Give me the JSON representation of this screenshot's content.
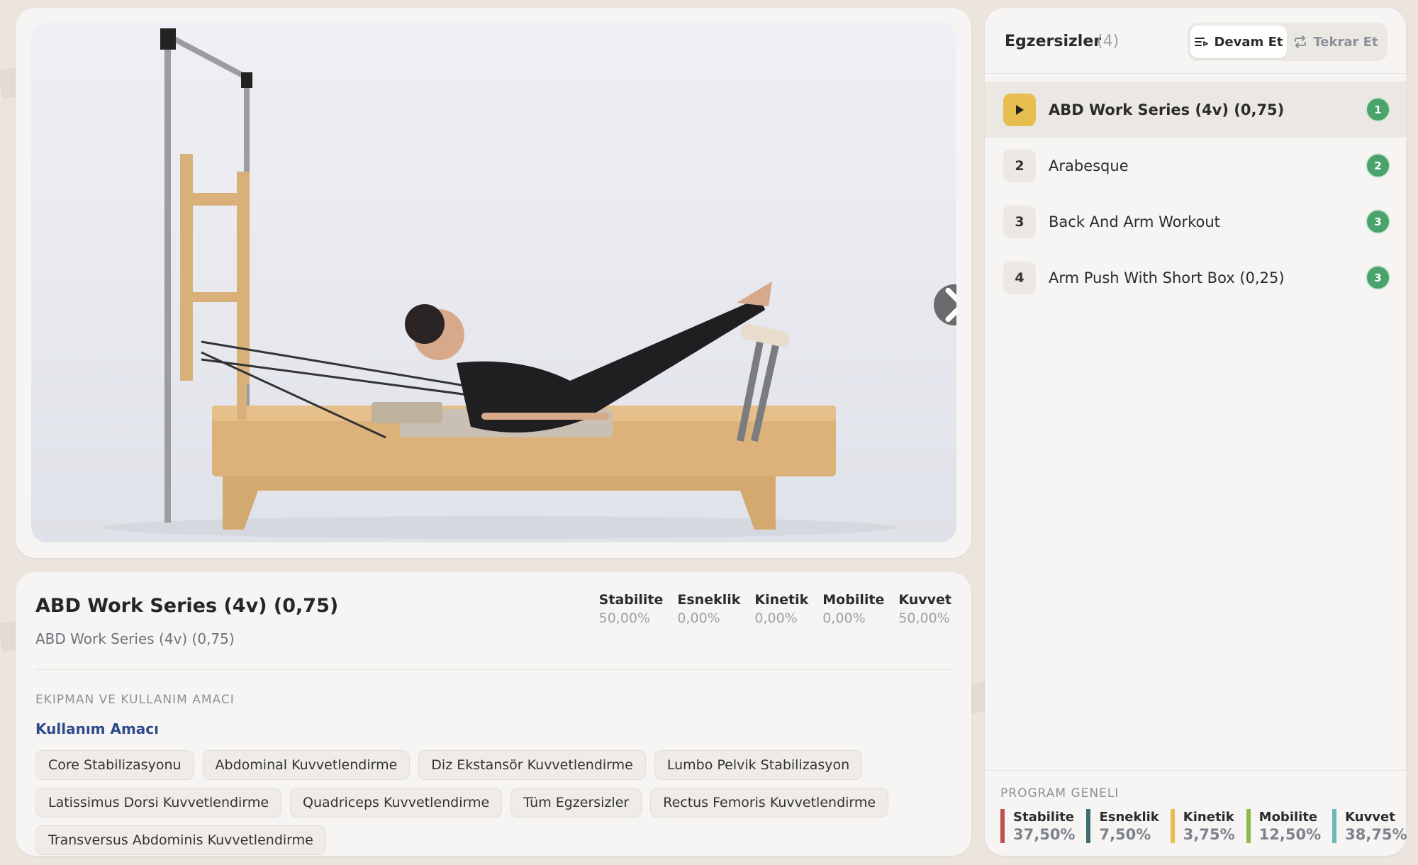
{
  "video": {
    "next_icon": "chevron-right-icon"
  },
  "exercise": {
    "title": "ABD Work Series (4v) (0,75)",
    "subtitle": "ABD Work Series (4v) (0,75)",
    "stats": [
      {
        "name": "Stabilite",
        "value": "50,00%"
      },
      {
        "name": "Esneklik",
        "value": "0,00%"
      },
      {
        "name": "Kinetik",
        "value": "0,00%"
      },
      {
        "name": "Mobilite",
        "value": "0,00%"
      },
      {
        "name": "Kuvvet",
        "value": "50,00%"
      }
    ],
    "section_label": "EKIPMAN VE KULLANIM AMACI",
    "usage_title": "Kullanım Amacı",
    "tags": [
      "Core Stabilizasyonu",
      "Abdominal Kuvvetlendirme",
      "Diz Ekstansör Kuvvetlendirme",
      "Lumbo Pelvik Stabilizasyon",
      "Latissimus Dorsi Kuvvetlendirme",
      "Quadriceps Kuvvetlendirme",
      "Tüm Egzersizler",
      "Rectus Femoris Kuvvetlendirme",
      "Transversus Abdominis Kuvvetlendirme"
    ]
  },
  "sidebar": {
    "title": "Egzersizler",
    "count": "(4)",
    "mode_continue": "Devam Et",
    "mode_repeat": "Tekrar Et",
    "items": [
      {
        "num": "",
        "name": "ABD Work Series (4v) (0,75)",
        "badge": "1",
        "active": true
      },
      {
        "num": "2",
        "name": "Arabesque",
        "badge": "2",
        "active": false
      },
      {
        "num": "3",
        "name": "Back And Arm Workout",
        "badge": "3",
        "active": false
      },
      {
        "num": "4",
        "name": "Arm Push With Short Box (0,25)",
        "badge": "3",
        "active": false
      }
    ],
    "program_label": "PROGRAM GENELI",
    "program_stats": [
      {
        "name": "Stabilite",
        "value": "37,50%",
        "color": "#c0504d"
      },
      {
        "name": "Esneklik",
        "value": "7,50%",
        "color": "#3f6e70"
      },
      {
        "name": "Kinetik",
        "value": "3,75%",
        "color": "#e6bd4e"
      },
      {
        "name": "Mobilite",
        "value": "12,50%",
        "color": "#8cb84a"
      },
      {
        "name": "Kuvvet",
        "value": "38,75%",
        "color": "#6ab8b8"
      }
    ]
  },
  "colors": {
    "accent_blue": "#2e4a8c",
    "active_play": "#e6bd4e",
    "badge_green": "#4aa36a"
  }
}
